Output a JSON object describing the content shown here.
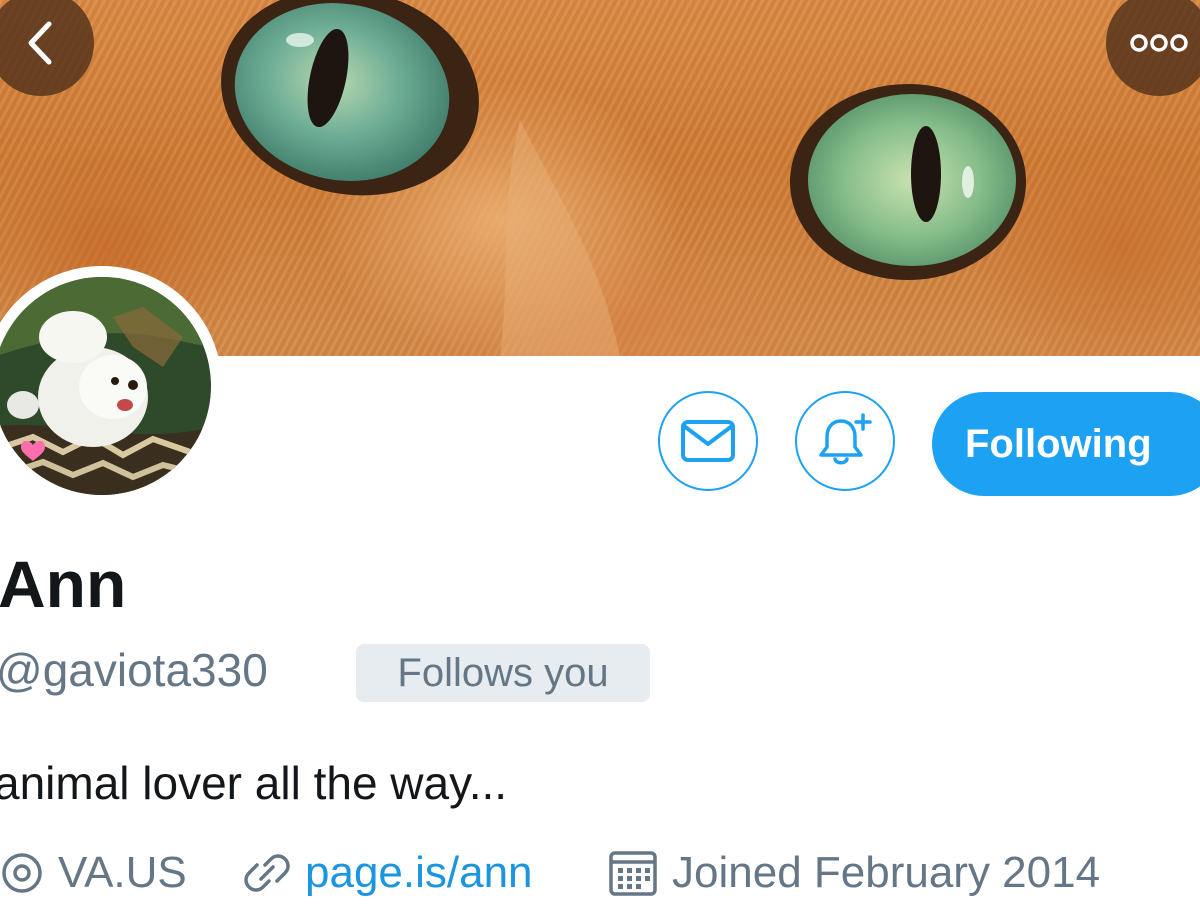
{
  "header": {
    "back_icon": "chevron-left-icon",
    "more_icon": "more-horizontal-icon"
  },
  "actions": {
    "message_icon": "envelope-icon",
    "notify_icon": "bell-plus-icon",
    "follow_label": "Following"
  },
  "profile": {
    "name": "Ann",
    "handle": "@gaviota330",
    "follows_you": "Follows you",
    "bio": "animal lover all the way...",
    "location": "VA.US",
    "website": "page.is/ann",
    "joined": "Joined February 2014"
  },
  "colors": {
    "accent": "#1da1f2",
    "link": "#1b95e0",
    "secondary_text": "#657786",
    "badge_bg": "#e6ecf0"
  }
}
